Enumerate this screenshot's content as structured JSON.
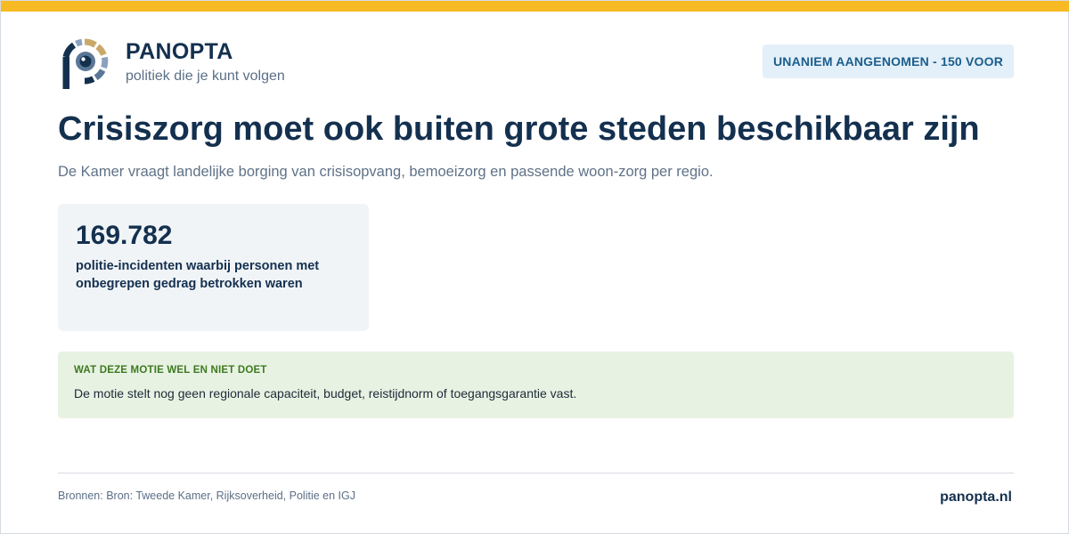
{
  "colors": {
    "accent_bar": "#f7b924",
    "brand_navy": "#14304f",
    "badge_bg": "#e3eff9",
    "badge_text": "#1a5e8c",
    "note_bg": "#e8f2e3",
    "note_heading": "#3d7a1f",
    "stat_bg": "#f1f4f7"
  },
  "brand": {
    "logo_icon": "panopta-eye-logo-icon",
    "name": "PANOPTA",
    "tagline": "politiek die je kunt volgen"
  },
  "badge": {
    "label": "UNANIEM AANGENOMEN - 150 VOOR"
  },
  "headline": {
    "title": "Crisiszorg moet ook buiten grote steden beschikbaar zijn",
    "subtitle": "De Kamer vraagt landelijke borging van crisisopvang, bemoeizorg en passende woon-zorg per regio."
  },
  "stat": {
    "value": "169.782",
    "label": "politie-incidenten waarbij personen met onbegrepen gedrag betrokken waren"
  },
  "note": {
    "heading": "WAT DEZE MOTIE WEL EN NIET DOET",
    "text": "De motie stelt nog geen regionale capaciteit, budget, reistijdnorm of toegangsgarantie vast."
  },
  "footer": {
    "sources": "Bronnen: Bron: Tweede Kamer, Rijksoverheid, Politie en IGJ",
    "site": "panopta.nl"
  }
}
